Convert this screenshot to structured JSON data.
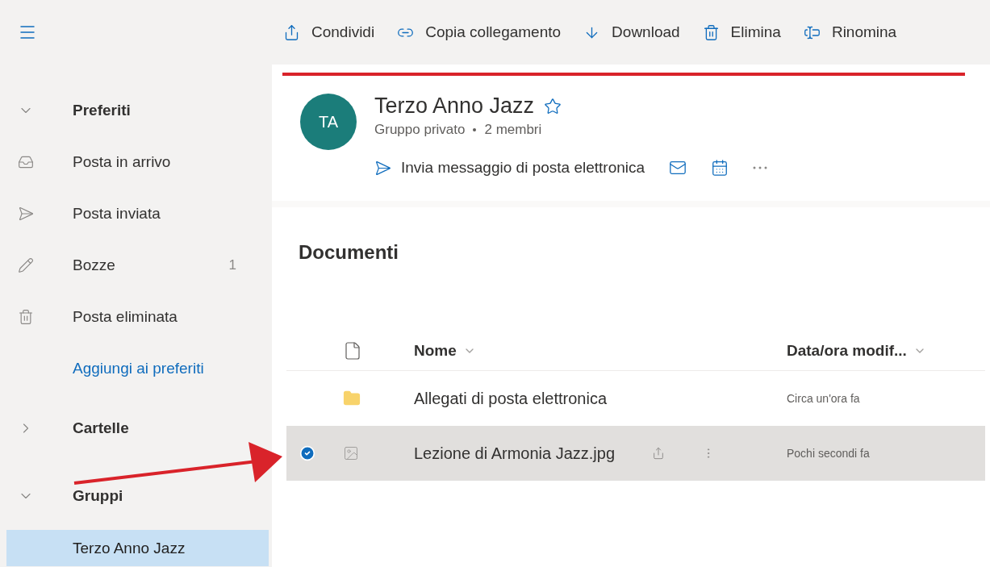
{
  "toolbar": [
    {
      "kind": "share",
      "label": "Condividi"
    },
    {
      "kind": "link",
      "label": "Copia collegamento"
    },
    {
      "kind": "download",
      "label": "Download"
    },
    {
      "kind": "delete",
      "label": "Elimina"
    },
    {
      "kind": "rename",
      "label": "Rinomina"
    }
  ],
  "sidebar": {
    "items": [
      {
        "kind": "section",
        "label": "Preferiti",
        "expanded": true
      },
      {
        "kind": "inbox",
        "label": "Posta in arrivo",
        "selected": false
      },
      {
        "kind": "sent",
        "label": "Posta inviata",
        "selected": false
      },
      {
        "kind": "drafts",
        "label": "Bozze",
        "count": "1",
        "selected": false
      },
      {
        "kind": "deleted",
        "label": "Posta eliminata",
        "selected": false
      },
      {
        "kind": "link",
        "label": "Aggiungi ai preferiti"
      },
      {
        "kind": "section",
        "label": "Cartelle",
        "expanded": false
      },
      {
        "kind": "section",
        "label": "Gruppi",
        "expanded": true
      },
      {
        "kind": "group",
        "label": "Terzo Anno Jazz",
        "selected": true
      }
    ]
  },
  "group": {
    "initials": "TA",
    "name": "Terzo Anno Jazz",
    "favorite": false,
    "type": "Gruppo privato",
    "members": "2 membri",
    "send_label": "Invia messaggio di posta elettronica"
  },
  "documents": {
    "title": "Documenti",
    "columns": [
      "Nome",
      "Data/ora modif..."
    ],
    "rows": [
      {
        "kind": "folder",
        "name": "Allegati di posta elettronica",
        "modified": "Circa un'ora fa",
        "selected": false
      },
      {
        "kind": "image",
        "name": "Lezione di Armonia Jazz.jpg",
        "modified": "Pochi secondi fa",
        "selected": true
      }
    ]
  }
}
